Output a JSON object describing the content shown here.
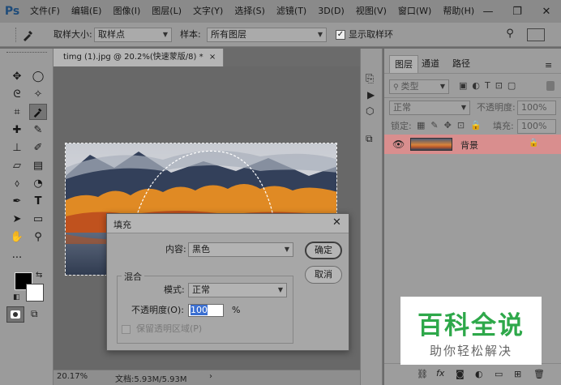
{
  "app": {
    "logo": "Ps",
    "menu": [
      "文件(F)",
      "编辑(E)",
      "图像(I)",
      "图层(L)",
      "文字(Y)",
      "选择(S)",
      "滤镜(T)",
      "3D(D)",
      "视图(V)",
      "窗口(W)",
      "帮助(H)"
    ],
    "window_controls": [
      "—",
      "❐",
      "✕"
    ]
  },
  "options": {
    "sample_size_label": "取样大小:",
    "sample_size_value": "取样点",
    "sample_label": "样本:",
    "sample_value": "所有图层",
    "show_ring_label": "显示取样环"
  },
  "document": {
    "tab_title": "timg (1).jpg @ 20.2%(快速蒙版/8) *",
    "tab_close": "×",
    "zoom": "20.17%",
    "doc_info": "文档:5.93M/5.93M",
    "status_arrow": "›"
  },
  "layers_panel": {
    "tabs": [
      "图层",
      "通道",
      "路径"
    ],
    "filter_placeholder": "类型",
    "blend_mode": "正常",
    "opacity_label": "不透明度:",
    "opacity_value": "100%",
    "lock_label": "锁定:",
    "fill_label": "填充:",
    "fill_value": "100%",
    "layer_name": "背景"
  },
  "dialog": {
    "title": "填充",
    "contents_label": "内容:",
    "contents_value": "黑色",
    "ok_label": "确定",
    "cancel_label": "取消",
    "blending_label": "混合",
    "mode_label": "模式:",
    "mode_value": "正常",
    "opacity_label": "不透明度(O):",
    "opacity_value": "100",
    "opacity_unit": "%",
    "preserve_label": "保留透明区域(P)"
  },
  "watermark": {
    "title": "百科全说",
    "subtitle": "助你轻松解决"
  },
  "colors": {
    "watermark_green": "#2ea84a",
    "layer_highlight": "#d98e8e",
    "selection_blue": "#3b6fd1"
  }
}
